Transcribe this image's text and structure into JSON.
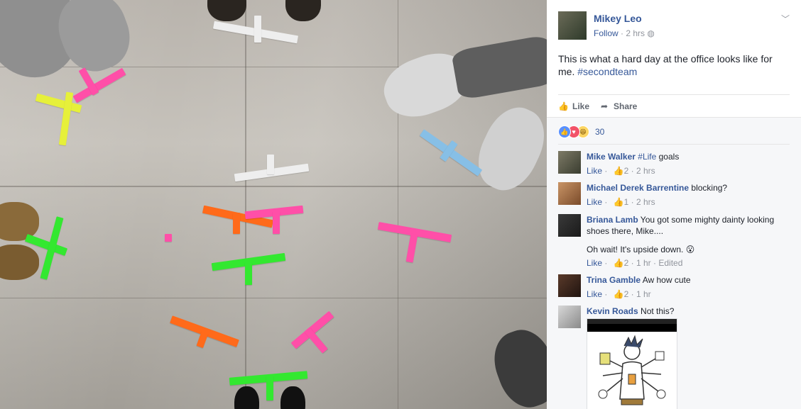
{
  "post": {
    "author": "Mikey Leo",
    "follow_label": "Follow",
    "time": "2 hrs",
    "text": "This is what a hard day at the office looks like for me.",
    "hashtag": "#secondteam",
    "like_label": "Like",
    "share_label": "Share",
    "reaction_count": "30"
  },
  "comments": [
    {
      "name": "Mike Walker",
      "tag": "#Life",
      "text": " goals",
      "like": "Like",
      "likes": "2",
      "time": "2 hrs"
    },
    {
      "name": "Michael Derek Barrentine",
      "text": " blocking?",
      "like": "Like",
      "likes": "1",
      "time": "2 hrs"
    },
    {
      "name": "Briana Lamb",
      "text": " You got some mighty dainty looking shoes there, Mike....",
      "text2": "Oh wait! It's upside down.",
      "emoji": "😮",
      "like": "Like",
      "likes": "2",
      "time": "1 hr",
      "edited": "Edited"
    },
    {
      "name": "Trina Gamble",
      "text": " Aw how cute",
      "like": "Like",
      "likes": "2",
      "time": "1 hr"
    },
    {
      "name": "Kevin Roads",
      "text": " Not this?"
    }
  ],
  "icons": {
    "like": "thumbs-up-icon",
    "share": "share-arrow-icon",
    "globe": "globe-icon",
    "menu": "chevron-down-icon"
  },
  "colors": {
    "link": "#365899",
    "meta": "#90949c",
    "like_reaction": "#5890ff",
    "love_reaction": "#f25268",
    "haha_reaction": "#fcd663"
  }
}
